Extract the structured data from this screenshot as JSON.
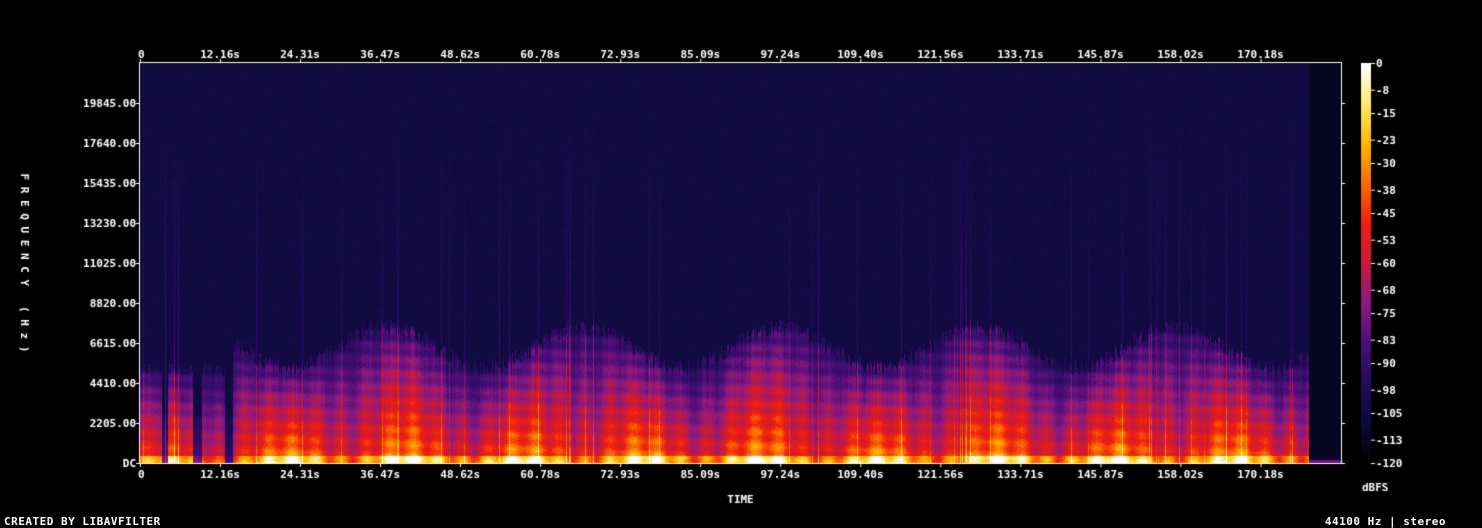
{
  "chart_data": {
    "type": "heatmap",
    "subtype": "spectrogram",
    "xlabel": "TIME",
    "ylabel": "FREQUENCY (Hz)",
    "x_ticks": [
      "0",
      "12.16s",
      "24.31s",
      "36.47s",
      "48.62s",
      "60.78s",
      "72.93s",
      "85.09s",
      "97.24s",
      "109.40s",
      "121.56s",
      "133.71s",
      "145.87s",
      "158.02s",
      "170.18s"
    ],
    "x_tick_values": [
      0,
      12.16,
      24.31,
      36.47,
      48.62,
      60.78,
      72.93,
      85.09,
      97.24,
      109.4,
      121.56,
      133.71,
      145.87,
      158.02,
      170.18
    ],
    "xlim": [
      0,
      182.4
    ],
    "y_ticks": [
      "DC",
      "2205.00",
      "4410.00",
      "6615.00",
      "8820.00",
      "11025.00",
      "13230.00",
      "15435.00",
      "17640.00",
      "19845.00"
    ],
    "y_tick_values": [
      0,
      2205,
      4410,
      6615,
      8820,
      11025,
      13230,
      15435,
      17640,
      19845
    ],
    "ylim": [
      0,
      22050
    ],
    "audio_end_time": 177.5,
    "colorbar": {
      "label": "dBFS",
      "ticks": [
        "0",
        "-8",
        "-15",
        "-23",
        "-30",
        "-38",
        "-45",
        "-53",
        "-60",
        "-68",
        "-75",
        "-83",
        "-90",
        "-98",
        "-105",
        "-113",
        "-120"
      ],
      "tick_values": [
        0,
        -8,
        -15,
        -23,
        -30,
        -38,
        -45,
        -53,
        -60,
        -68,
        -75,
        -83,
        -90,
        -98,
        -105,
        -113,
        -120
      ],
      "range": [
        -120,
        0
      ],
      "colormap": [
        "#000000",
        "#0d0a3a",
        "#200c5a",
        "#4a0e78",
        "#8a1a80",
        "#c81a3c",
        "#ee1e10",
        "#ff6a00",
        "#ffb800",
        "#ffec70",
        "#ffffff"
      ]
    }
  },
  "footer": {
    "left": "CREATED BY LIBAVFILTER",
    "right": "44100 Hz | stereo"
  }
}
